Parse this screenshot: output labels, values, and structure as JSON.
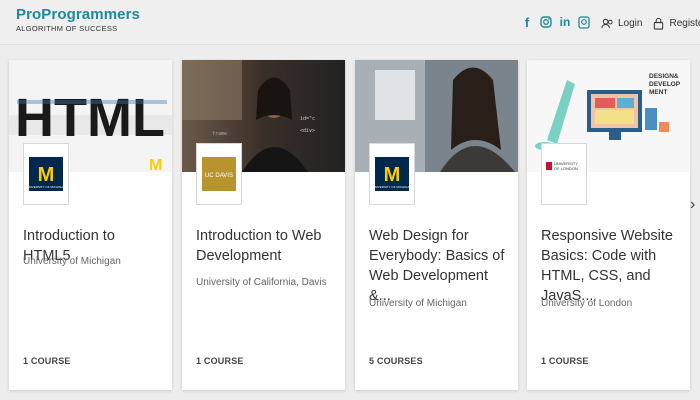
{
  "brand": {
    "name": "ProProgrammers",
    "tagline": "ALGORITHM OF SUCCESS"
  },
  "header": {
    "social": [
      "facebook-icon",
      "instagram-icon",
      "linkedin-icon",
      "whatsapp-icon"
    ],
    "login_label": "Login",
    "register_label": "Register"
  },
  "colors": {
    "brand": "#1f8a99",
    "michigan_blue": "#00274c",
    "michigan_maize": "#ffcb05",
    "davis_gold": "#b8942c"
  },
  "cards": [
    {
      "title": "Introduction to HTML5",
      "university": "University of Michigan",
      "count": "1 COURSE",
      "image_text": "HTML",
      "logo": "M"
    },
    {
      "title": "Introduction to Web Development",
      "university": "University of California, Davis",
      "count": "1 COURSE",
      "logo": "UC DAVIS"
    },
    {
      "title": "Web Design for Everybody: Basics of Web Development &...",
      "university": "University of Michigan",
      "count": "5 COURSES",
      "logo": "M"
    },
    {
      "title": "Responsive Website Basics: Code with HTML, CSS, and JavaS...",
      "university": "University of London",
      "count": "1 COURSE",
      "image_text": "DESIGN& DEVELOP MENT",
      "logo": "UNIVERSITY OF LONDON"
    }
  ],
  "nav": {
    "next": "›"
  }
}
